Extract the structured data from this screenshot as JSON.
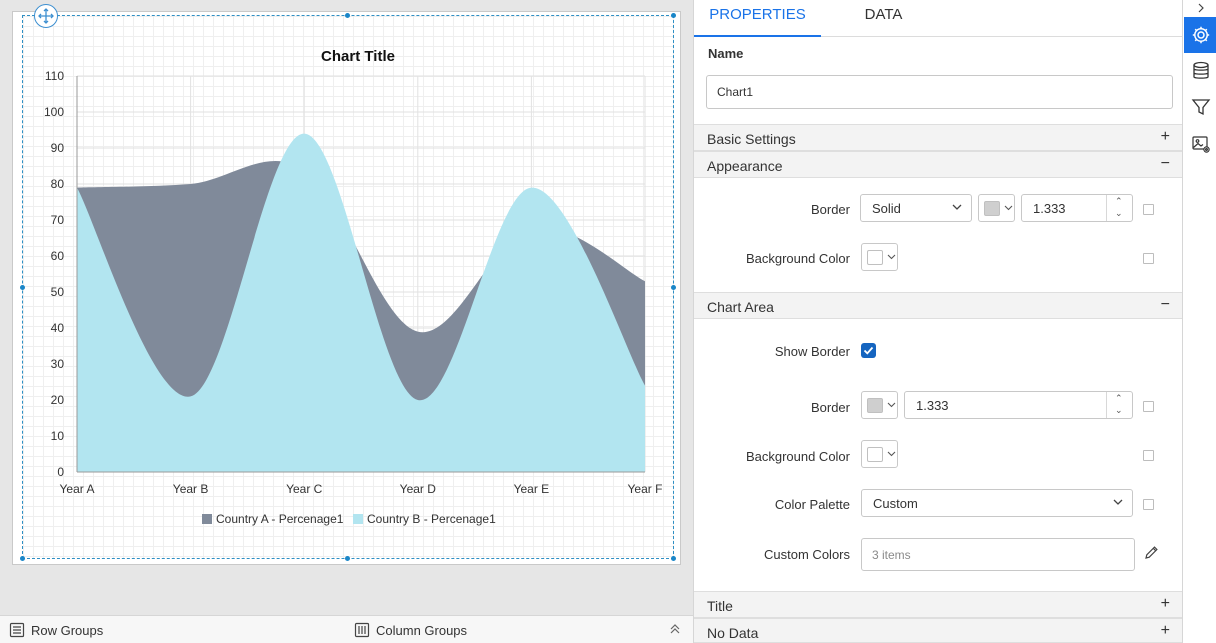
{
  "chart": {
    "title": "Chart Title",
    "y_ticks": [
      "0",
      "10",
      "20",
      "30",
      "40",
      "50",
      "60",
      "70",
      "80",
      "90",
      "100",
      "110"
    ],
    "x_ticks": [
      "Year A",
      "Year B",
      "Year C",
      "Year D",
      "Year E",
      "Year F"
    ],
    "legend": [
      "Country A - Percenage1",
      "Country B - Percenage1"
    ]
  },
  "chart_data": {
    "type": "area",
    "title": "Chart Title",
    "categories": [
      "Year A",
      "Year B",
      "Year C",
      "Year D",
      "Year E",
      "Year F"
    ],
    "ylim": [
      0,
      110
    ],
    "grid": true,
    "legend_position": "bottom",
    "smooth": true,
    "series": [
      {
        "name": "Country A - Percenage1",
        "color": "#808a9a",
        "values": [
          79,
          80,
          84,
          39,
          68,
          53
        ]
      },
      {
        "name": "Country B - Percenage1",
        "color": "#b2e5f0",
        "values": [
          79,
          21,
          94,
          20,
          79,
          24
        ]
      }
    ]
  },
  "bottom_bar": {
    "row_groups": "Row Groups",
    "column_groups": "Column Groups"
  },
  "tabs": {
    "properties": "PROPERTIES",
    "data": "DATA"
  },
  "name_section": {
    "label": "Name",
    "value": "Chart1"
  },
  "sections": {
    "basic_settings": "Basic Settings",
    "appearance": "Appearance",
    "chart_area": "Chart Area",
    "title": "Title",
    "no_data": "No Data",
    "expand_symbol": "+",
    "collapse_symbol": "−"
  },
  "appearance": {
    "border_label": "Border",
    "border_style": "Solid",
    "border_width": "1.333",
    "background_label": "Background Color"
  },
  "chart_area": {
    "show_border_label": "Show Border",
    "show_border": true,
    "border_label": "Border",
    "border_width": "1.333",
    "background_label": "Background Color",
    "palette_label": "Color Palette",
    "palette_value": "Custom",
    "custom_colors_label": "Custom Colors",
    "custom_colors_placeholder": "3 items"
  },
  "colors": {
    "accent": "#1a73e8",
    "series_a": "#808a9a",
    "series_b": "#b2e5f0"
  },
  "icons": [
    "move-icon",
    "row-groups-icon",
    "column-groups-icon",
    "collapse-up-icon",
    "expand-rail-icon",
    "settings-icon",
    "database-icon",
    "filter-icon",
    "image-settings-icon",
    "pencil-icon"
  ]
}
